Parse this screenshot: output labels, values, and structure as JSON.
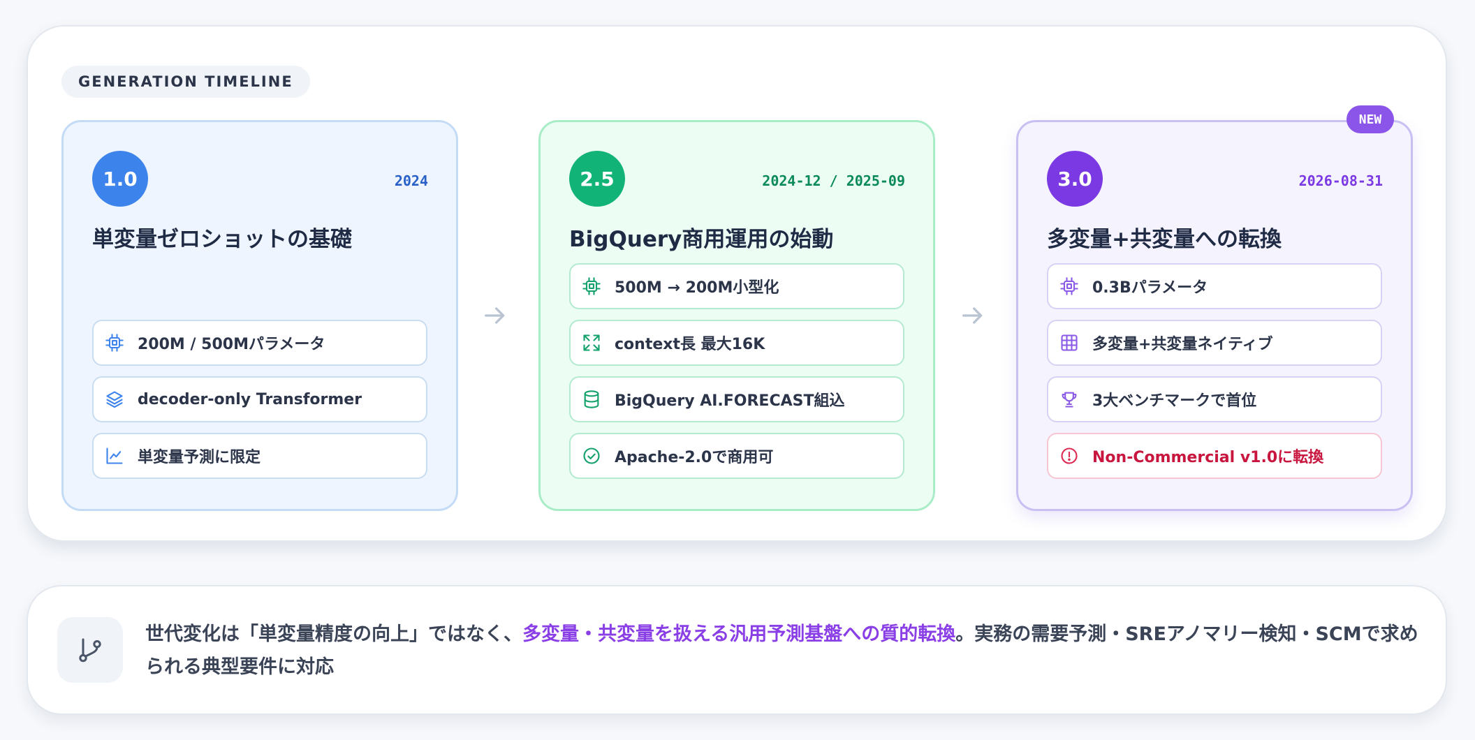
{
  "section_label": "GENERATION TIMELINE",
  "generations": [
    {
      "version": "1.0",
      "date": "2024",
      "title": "単変量ゼロショットの基礎",
      "features": [
        {
          "icon": "cpu-chip-icon",
          "text": "200M / 500Mパラメータ"
        },
        {
          "icon": "layers-icon",
          "text": "decoder-only Transformer"
        },
        {
          "icon": "line-chart-icon",
          "text": "単変量予測に限定"
        }
      ]
    },
    {
      "version": "2.5",
      "date": "2024-12 / 2025-09",
      "title": "BigQuery商用運用の始動",
      "features": [
        {
          "icon": "cpu-chip-icon",
          "text": "500M → 200M小型化"
        },
        {
          "icon": "expand-icon",
          "text": "context長 最大16K"
        },
        {
          "icon": "database-icon",
          "text": "BigQuery AI.FORECAST組込"
        },
        {
          "icon": "check-circle-icon",
          "text": "Apache-2.0で商用可"
        }
      ]
    },
    {
      "version": "3.0",
      "date": "2026-08-31",
      "title": "多変量+共変量への転換",
      "badge": "NEW",
      "features": [
        {
          "icon": "cpu-chip-icon",
          "text": "0.3Bパラメータ"
        },
        {
          "icon": "grid-icon",
          "text": "多変量+共変量ネイティブ"
        },
        {
          "icon": "trophy-icon",
          "text": "3大ベンチマークで首位"
        },
        {
          "icon": "alert-circle-icon",
          "text": "Non-Commercial v1.0に転換",
          "warning": true
        }
      ]
    }
  ],
  "summary": {
    "icon": "git-branch-icon",
    "text_before": "世代変化は「単変量精度の向上」ではなく、",
    "highlight": "多変量・共変量を扱える汎用予測基盤への質的転換",
    "text_after": "。実務の需要予測・SREアノマリー検知・SCMで求められる典型要件に対応"
  },
  "colors": {
    "gen1_accent": "#3d83ec",
    "gen2_accent": "#12b377",
    "gen3_accent": "#7a39e3",
    "warning": "#c8163f",
    "highlight": "#8a3ee6"
  }
}
